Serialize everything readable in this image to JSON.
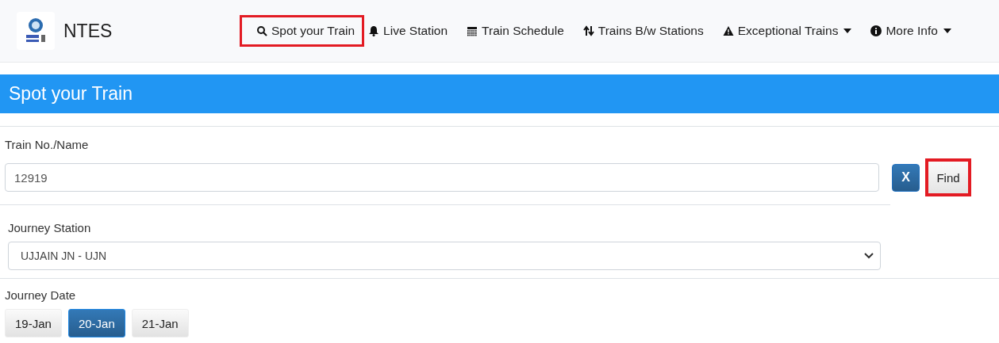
{
  "header": {
    "brand": "NTES",
    "nav": [
      {
        "label": "Spot your Train",
        "kind": "search",
        "highlighted": true,
        "dropdown": false
      },
      {
        "label": "Live Station",
        "kind": "bell",
        "highlighted": false,
        "dropdown": false
      },
      {
        "label": "Train Schedule",
        "kind": "calendar",
        "highlighted": false,
        "dropdown": false
      },
      {
        "label": "Trains B/w Stations",
        "kind": "arrows",
        "highlighted": false,
        "dropdown": false
      },
      {
        "label": "Exceptional Trains",
        "kind": "warning",
        "highlighted": false,
        "dropdown": true
      },
      {
        "label": "More Info",
        "kind": "info",
        "highlighted": false,
        "dropdown": true
      }
    ]
  },
  "page_title": "Spot your Train",
  "train_field": {
    "label": "Train No./Name",
    "value": "12919"
  },
  "clear_button": "X",
  "find_button": {
    "label": "Find",
    "highlighted": true
  },
  "station_field": {
    "label": "Journey Station",
    "value": "UJJAIN JN - UJN"
  },
  "date_field": {
    "label": "Journey Date",
    "dates": [
      {
        "label": "19-Jan",
        "selected": false
      },
      {
        "label": "20-Jan",
        "selected": true
      },
      {
        "label": "21-Jan",
        "selected": false
      }
    ]
  }
}
